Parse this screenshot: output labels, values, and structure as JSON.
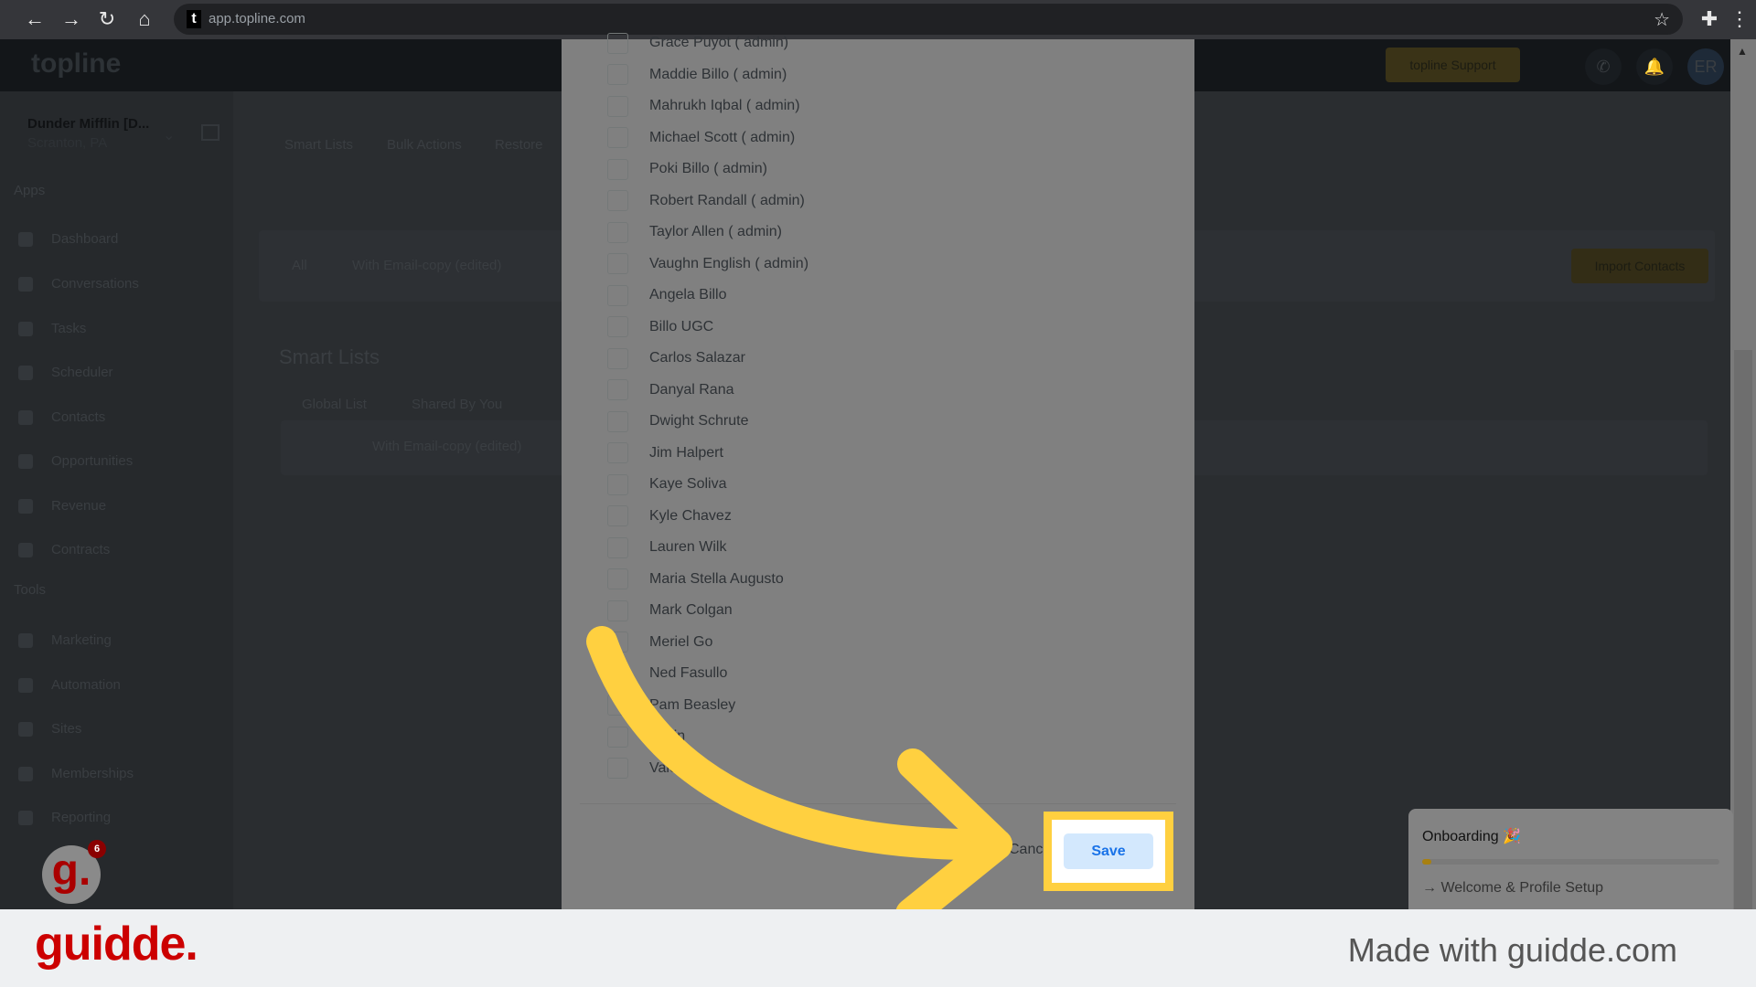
{
  "browser": {
    "url": "app.topline.com"
  },
  "header": {
    "logo": "topline",
    "support_label": "topline Support",
    "avatar": "ER"
  },
  "sidebar": {
    "org_name": "Dunder Mifflin [D...",
    "org_location": "Scranton, PA",
    "apps_label": "Apps",
    "tools_label": "Tools",
    "apps": [
      "Dashboard",
      "Conversations",
      "Tasks",
      "Scheduler",
      "Contacts",
      "Opportunities",
      "Revenue",
      "Contracts"
    ],
    "tools": [
      "Marketing",
      "Automation",
      "Sites",
      "Memberships",
      "Reporting"
    ]
  },
  "main": {
    "tabs": [
      "Smart Lists",
      "Bulk Actions",
      "Restore"
    ],
    "filters": [
      "All",
      "With Email-copy (edited)"
    ],
    "import_label": "Import Contacts",
    "section_title": "Smart Lists",
    "sub_tabs": [
      "Global List",
      "Shared By You"
    ],
    "list_row": "With Email-copy (edited)"
  },
  "modal": {
    "users": [
      "Grace Puyot ( admin)",
      "Maddie Billo ( admin)",
      "Mahrukh Iqbal ( admin)",
      "Michael Scott ( admin)",
      "Poki Billo ( admin)",
      "Robert Randall ( admin)",
      "Taylor Allen ( admin)",
      "Vaughn English ( admin)",
      "Angela Billo",
      "Billo UGC",
      "Carlos Salazar",
      "Danyal Rana",
      "Dwight Schrute",
      "Jim Halpert",
      "Kaye Soliva",
      "Kyle Chavez",
      "Lauren Wilk",
      "Maria Stella Augusto",
      "Mark Colgan",
      "Meriel Go",
      "Ned Fasullo",
      "Pam Beasley",
      "Lapin",
      "Vale"
    ],
    "cancel_label": "Cancel",
    "save_label": "Save"
  },
  "onboarding": {
    "title": "Onboarding 🎉",
    "progress_percent": 3,
    "step": "Welcome & Profile Setup"
  },
  "guidde": {
    "logo": "guidde.",
    "badge_count": "6",
    "made_with": "Made with guidde.com"
  },
  "colors": {
    "highlight": "#ffd040",
    "save_text": "#1a73e8",
    "brand_red": "#cc0000"
  }
}
